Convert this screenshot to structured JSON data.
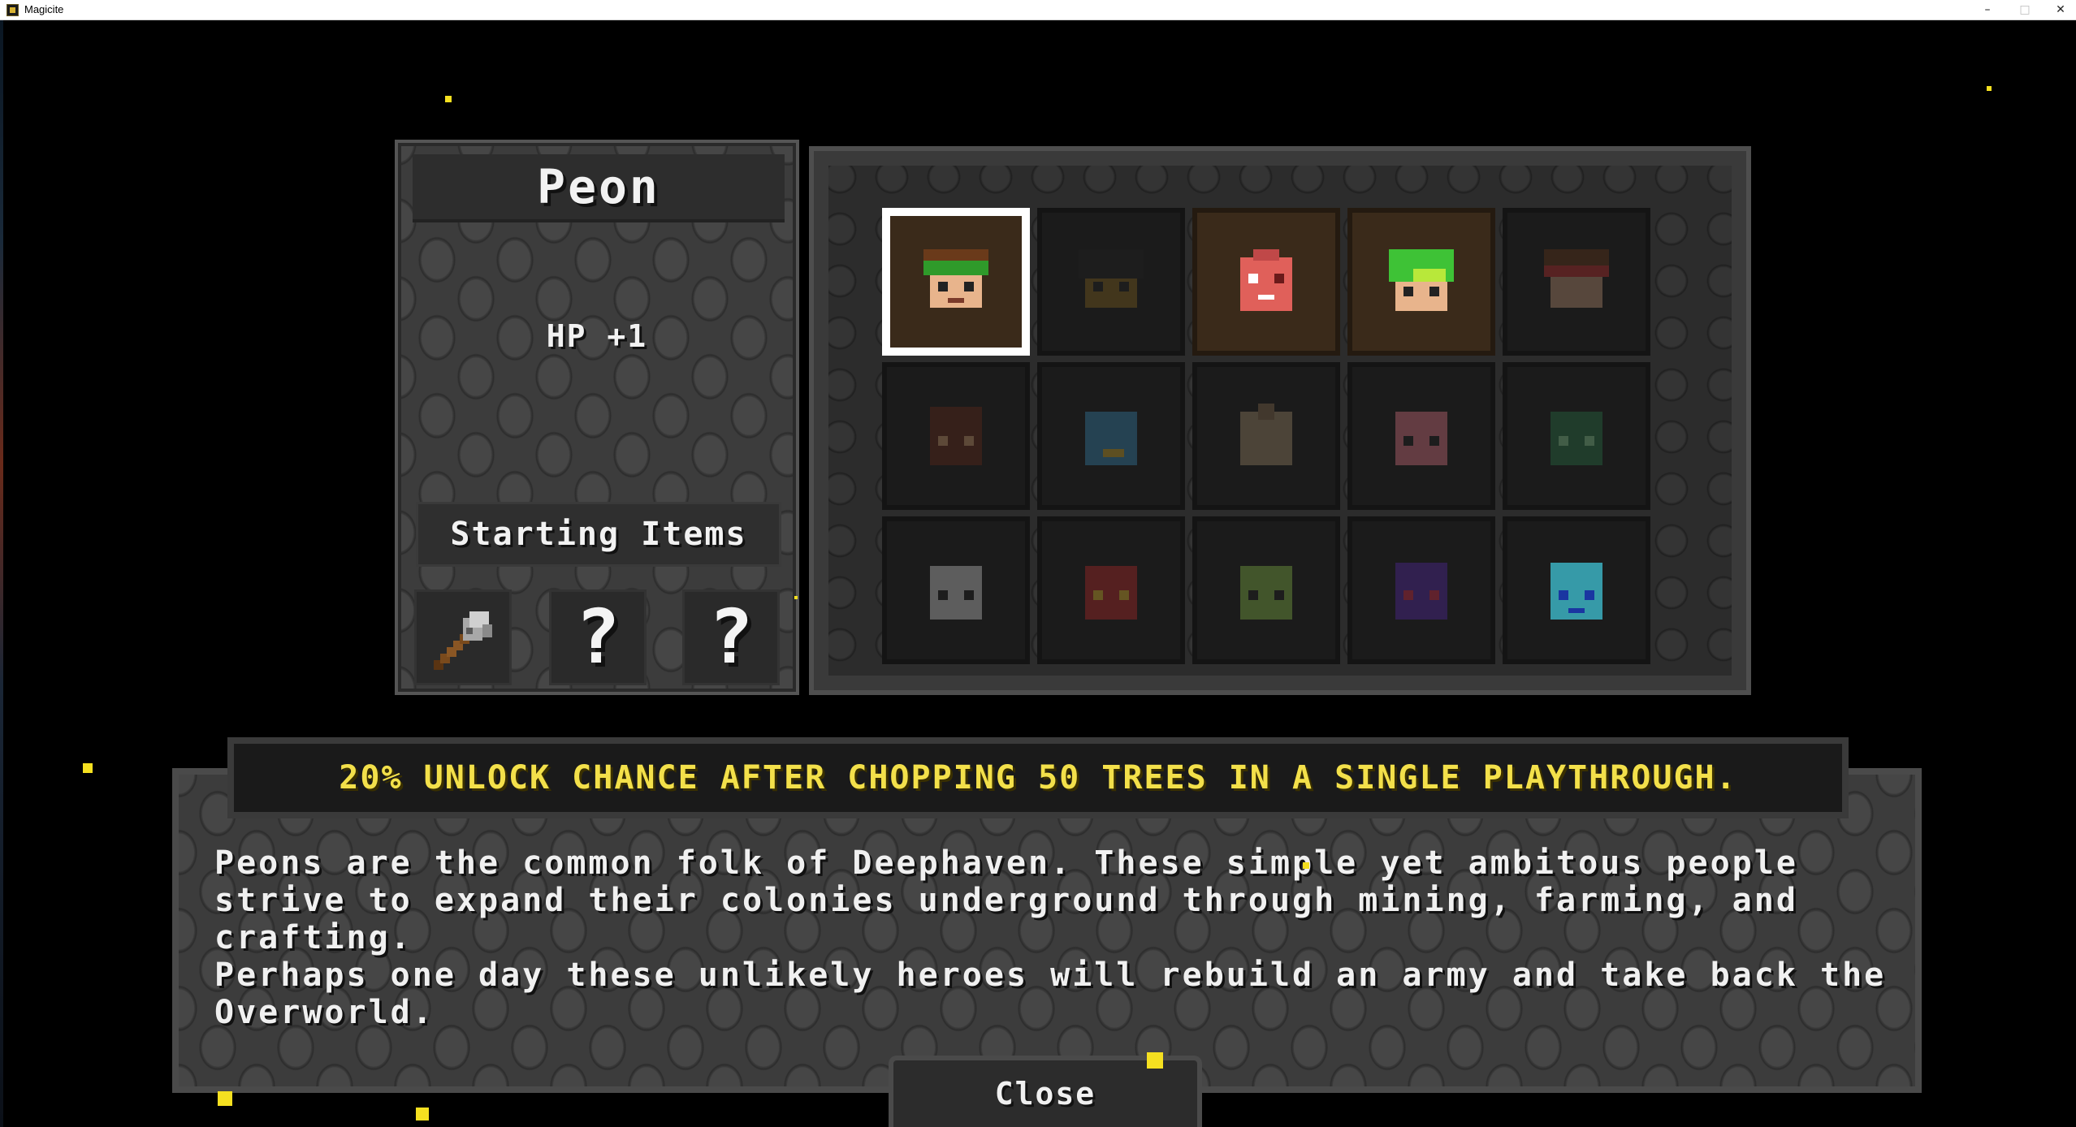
{
  "window": {
    "title": "Magicite",
    "minimize": "–",
    "maximize": "□",
    "close": "✕"
  },
  "class_panel": {
    "name": "Peon",
    "stat": "HP +1",
    "starting_items_label": "Starting Items",
    "items": [
      {
        "icon": "axe-icon",
        "label": ""
      },
      {
        "icon": "unknown-item-icon",
        "label": "?"
      },
      {
        "icon": "unknown-item-icon",
        "label": "?"
      }
    ]
  },
  "grid": {
    "rows": [
      [
        {
          "state": "selected",
          "icon": "peon-portrait-icon"
        },
        {
          "state": "locked",
          "icon": "dark-knight-portrait-icon"
        },
        {
          "state": "unlocked",
          "icon": "pink-creature-portrait-icon"
        },
        {
          "state": "unlocked",
          "icon": "green-hair-portrait-icon"
        },
        {
          "state": "locked",
          "icon": "bandit-portrait-icon"
        }
      ],
      [
        {
          "state": "locked",
          "icon": "brown-creature-portrait-icon"
        },
        {
          "state": "locked",
          "icon": "blue-bird-portrait-icon"
        },
        {
          "state": "locked",
          "icon": "spiky-creature-portrait-icon"
        },
        {
          "state": "locked",
          "icon": "pink-blob-portrait-icon"
        },
        {
          "state": "locked",
          "icon": "green-goblin-portrait-icon"
        }
      ],
      [
        {
          "state": "locked",
          "icon": "white-ghost-portrait-icon"
        },
        {
          "state": "locked",
          "icon": "red-beast-portrait-icon"
        },
        {
          "state": "locked",
          "icon": "green-slime-portrait-icon"
        },
        {
          "state": "locked",
          "icon": "purple-demon-portrait-icon"
        },
        {
          "state": "locked",
          "icon": "cyan-crystal-portrait-icon"
        }
      ]
    ]
  },
  "unlock_text": "20% UNLOCK CHANCE AFTER CHOPPING 50 TREES IN A SINGLE PLAYTHROUGH.",
  "description": [
    "Peons are the common folk of Deephaven. These simple yet ambitous people",
    "strive to expand their colonies underground through mining, farming, and crafting.",
    "Perhaps one day these unlikely heroes will rebuild an army and take back the",
    "Overworld."
  ],
  "close_button": "Close",
  "colors": {
    "unlock_text": "#f3e04a",
    "selected_border": "#ffffff",
    "stone": "#3c3c3c"
  }
}
